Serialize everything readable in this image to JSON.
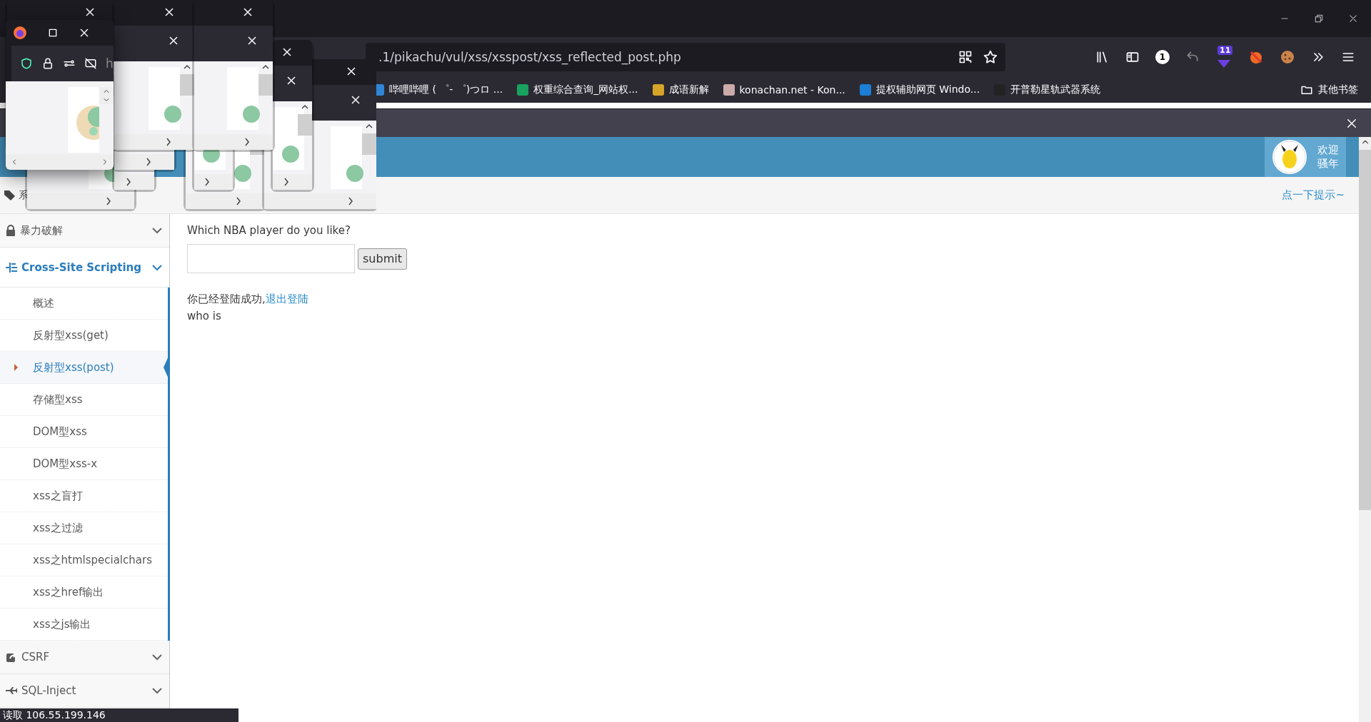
{
  "address_bar": {
    "url": ".1/pikachu/vul/xss/xsspost/xss_reflected_post.php"
  },
  "toolbar": {
    "account_badge": "1",
    "extension_badge": "11"
  },
  "bookmarks": [
    {
      "label": "哔哩哔哩 ( ゜- ゜)つロ ..."
    },
    {
      "label": "权重综合查询_网站权..."
    },
    {
      "label": "成语新解"
    },
    {
      "label": "konachan.net - Kon..."
    },
    {
      "label": "提权辅助网页 Windo..."
    },
    {
      "label": "开普勒星轨武器系统"
    }
  ],
  "other_bookmarks": "其他书签",
  "popups": [
    {
      "kind": "window"
    },
    {
      "kind": "window"
    },
    {
      "kind": "window"
    },
    {
      "kind": "window"
    },
    {
      "kind": "window"
    },
    {
      "kind": "window"
    },
    {
      "kind": "window"
    },
    {
      "kind": "window"
    },
    {
      "kind": "window"
    },
    {
      "kind": "window"
    },
    {
      "kind": "window",
      "url_fragment": "h"
    }
  ],
  "header": {
    "welcome": "欢迎",
    "user": "骚年"
  },
  "breadcrumb": {
    "section_fragment": "系",
    "hint_link": "点一下提示~"
  },
  "sidebar": [
    {
      "label": "暴力破解",
      "selected": false,
      "expanded": false
    },
    {
      "label": "Cross-Site Scripting",
      "selected": true,
      "expanded": true,
      "children": [
        {
          "label": "概述",
          "selected": false
        },
        {
          "label": "反射型xss(get)",
          "selected": false
        },
        {
          "label": "反射型xss(post)",
          "selected": true
        },
        {
          "label": "存储型xss",
          "selected": false
        },
        {
          "label": "DOM型xss",
          "selected": false
        },
        {
          "label": "DOM型xss-x",
          "selected": false
        },
        {
          "label": "xss之盲打",
          "selected": false
        },
        {
          "label": "xss之过滤",
          "selected": false
        },
        {
          "label": "xss之htmlspecialchars",
          "selected": false
        },
        {
          "label": "xss之href输出",
          "selected": false
        },
        {
          "label": "xss之js输出",
          "selected": false
        }
      ]
    },
    {
      "label": "CSRF",
      "selected": false,
      "expanded": false
    },
    {
      "label": "SQL-Inject",
      "selected": false,
      "expanded": false
    }
  ],
  "content": {
    "question": "Which NBA player do you like?",
    "button": "submit",
    "login_message": "你已经登陆成功,",
    "logout_link": "退出登陆",
    "result": "who is"
  },
  "status": "读取 106.55.199.146"
}
